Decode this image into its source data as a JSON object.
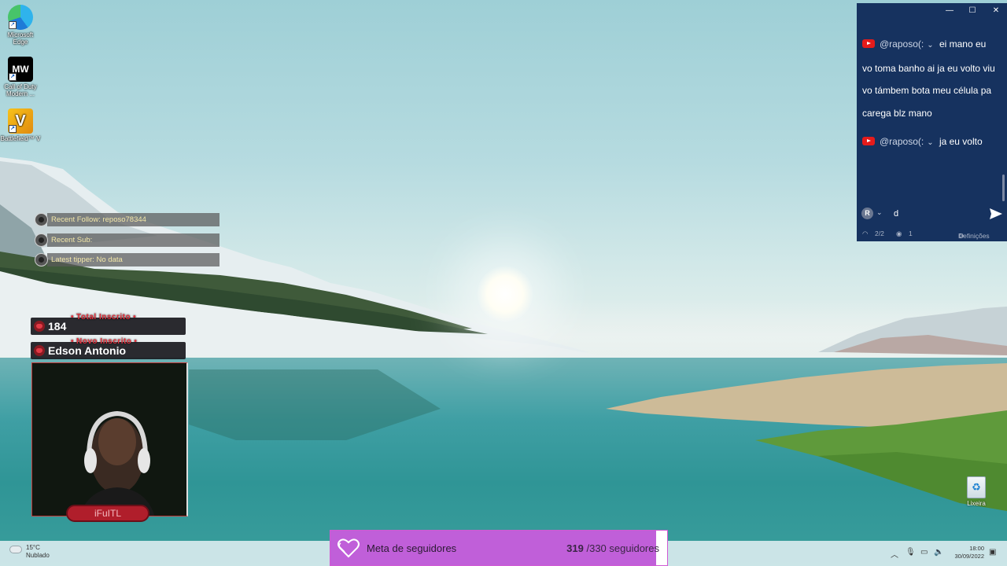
{
  "desktop": {
    "icons": [
      {
        "label": "Microsoft Edge",
        "icon": "edge-icon"
      },
      {
        "label": "Call of Duty Modern ...",
        "icon": "call-of-duty-icon"
      },
      {
        "label": "Battlefield™ V",
        "icon": "battlefield-icon"
      }
    ],
    "recycle_bin": {
      "label": "Lixeira",
      "icon": "recycle-bin-icon"
    }
  },
  "overlay": {
    "recent_follow": "Recent Follow: reposo78344",
    "recent_sub": "Recent Sub:",
    "latest_tipper": "Latest tipper: No data",
    "total_inscrito": {
      "caption": "Total Inscrito",
      "value": "184"
    },
    "novo_inscrito": {
      "caption": "Novo Inscrito",
      "value": "Edson Antonio"
    },
    "webcam": {
      "viewer_count": "0",
      "name_tag": "iFuITL"
    }
  },
  "chat": {
    "messages": [
      {
        "user": "@raposo(:",
        "text": "ei mano eu vo toma banho ai ja eu volto viu vo támbem bota meu célula pa carega blz mano"
      },
      {
        "user": "@raposo(:",
        "text": "ja eu volto"
      }
    ],
    "input": {
      "avatar_letter": "R",
      "typed": "d"
    },
    "footer": {
      "count": "2/2",
      "viewers": "1",
      "settings": "Definições"
    },
    "colors": {
      "background": "#16325f",
      "youtube": "#e51b1b"
    }
  },
  "goal": {
    "label": "Meta de seguidores",
    "current": "319",
    "target": "/330 seguidores",
    "progress": 0.9667,
    "color": "#c05fd9"
  },
  "taskbar": {
    "weather": {
      "temp": "15°C",
      "condition": "Nublado"
    },
    "time": "18:00",
    "date": "30/09/2022"
  }
}
